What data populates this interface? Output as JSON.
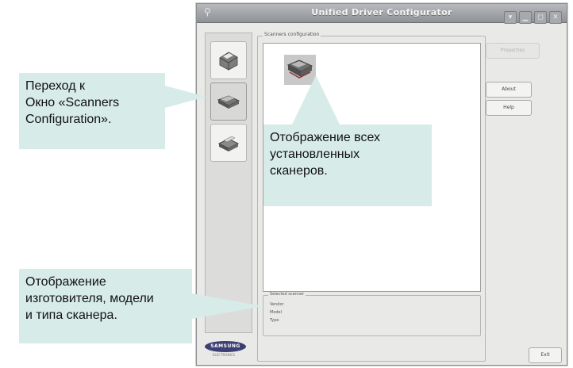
{
  "window": {
    "title": "Unified Driver Configurator",
    "title_icon": "⚲",
    "controls": [
      "▾",
      "▁",
      "◻",
      "✕"
    ]
  },
  "tools": [
    {
      "name": "printers-config-button",
      "active": false
    },
    {
      "name": "scanners-config-button",
      "active": true
    },
    {
      "name": "ports-config-button",
      "active": false
    }
  ],
  "groupbox": {
    "title": "Scanners configuration"
  },
  "selected_scanner": {
    "title": "Selected scanner",
    "rows": [
      "Vendor",
      "Model",
      "Type"
    ]
  },
  "buttons": {
    "properties": "Properties",
    "about": "About",
    "help": "Help",
    "exit": "Exit"
  },
  "brand": {
    "logo": "SAMSUNG",
    "sub": "ELECTRONICS"
  },
  "callouts": {
    "left_top": [
      "Переход к",
      "Окно «Scanners",
      "Configuration»."
    ],
    "center": [
      "Отображение всех",
      "установленных",
      "сканеров."
    ],
    "left_bottom": [
      "Отображение",
      "изготовителя, модели",
      "и типа сканера."
    ]
  },
  "colors": {
    "callout_bg": "#d7ebe9",
    "titlebar": "#9a9ca0",
    "window_bg": "#e9e9e7"
  }
}
